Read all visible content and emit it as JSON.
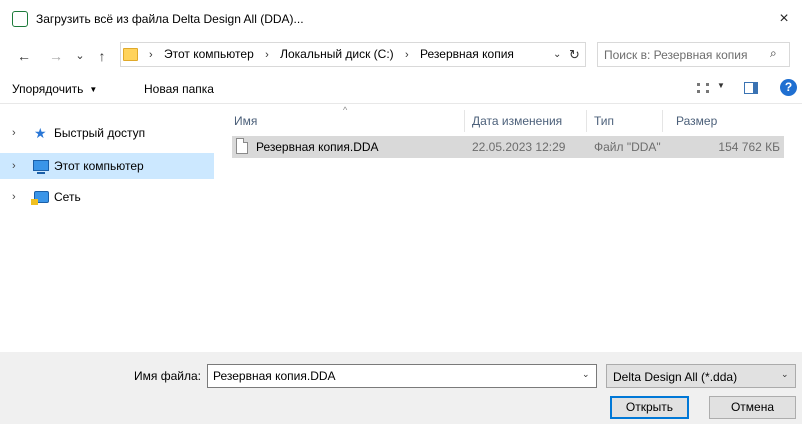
{
  "window": {
    "title": "Загрузить всё из файла Delta Design All (DDA)...",
    "close": "×"
  },
  "nav": {
    "back": "←",
    "forward": "→",
    "recent": "⌄",
    "up": "↑",
    "crumbs": [
      "Этот компьютер",
      "Локальный диск (C:)",
      "Резервная копия"
    ],
    "separator": "›",
    "dropdown": "⌄",
    "refresh": "↻",
    "search_placeholder": "Поиск в: Резервная копия",
    "search_glyph": "⌕"
  },
  "toolbar": {
    "organize": "Упорядочить",
    "organize_caret": "▼",
    "new_folder": "Новая папка",
    "view_caret": "▼",
    "help": "?"
  },
  "sidebar": {
    "items": [
      {
        "label": "Быстрый доступ",
        "chevron": "›",
        "icon": "star-icon",
        "selected": false
      },
      {
        "label": "Этот компьютер",
        "chevron": "›",
        "icon": "computer-icon",
        "selected": true
      },
      {
        "label": "Сеть",
        "chevron": "›",
        "icon": "network-icon",
        "selected": false
      }
    ]
  },
  "file_list": {
    "sort_caret": "^",
    "columns": {
      "name": "Имя",
      "date": "Дата изменения",
      "type": "Тип",
      "size": "Размер"
    },
    "rows": [
      {
        "name": "Резервная копия.DDA",
        "date": "22.05.2023 12:29",
        "type": "Файл \"DDA\"",
        "size": "154 762 КБ"
      }
    ]
  },
  "footer": {
    "filename_label": "Имя файла:",
    "filename_value": "Резервная копия.DDA",
    "filename_caret": "⌄",
    "filetype_value": "Delta Design All (*.dda)",
    "filetype_caret": "⌄",
    "open_label": "Открыть",
    "cancel_label": "Отмена"
  },
  "colors": {
    "selection": "#cce8ff",
    "file_row": "#d9d9d9",
    "accent": "#0078d7"
  }
}
